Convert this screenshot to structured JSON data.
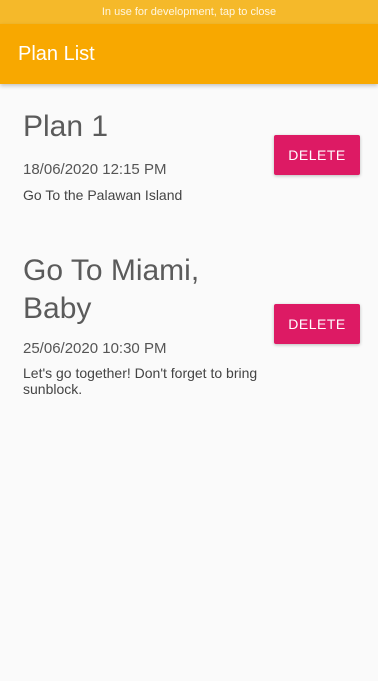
{
  "status_banner": {
    "text": "In use for development, tap to close"
  },
  "app_bar": {
    "title": "Plan List"
  },
  "plans": [
    {
      "title": "Plan 1",
      "date": "18/06/2020 12:15 PM",
      "description": "Go To the Palawan Island",
      "delete_label": "DELETE"
    },
    {
      "title": "Go To Miami, Baby",
      "date": "25/06/2020 10:30 PM",
      "description": "Let's go together! Don't forget to bring sunblock.",
      "delete_label": "DELETE"
    }
  ],
  "colors": {
    "banner": "#f5b92a",
    "app_bar": "#f8a800",
    "delete_button": "#dd1a64",
    "background": "#fafafa"
  }
}
